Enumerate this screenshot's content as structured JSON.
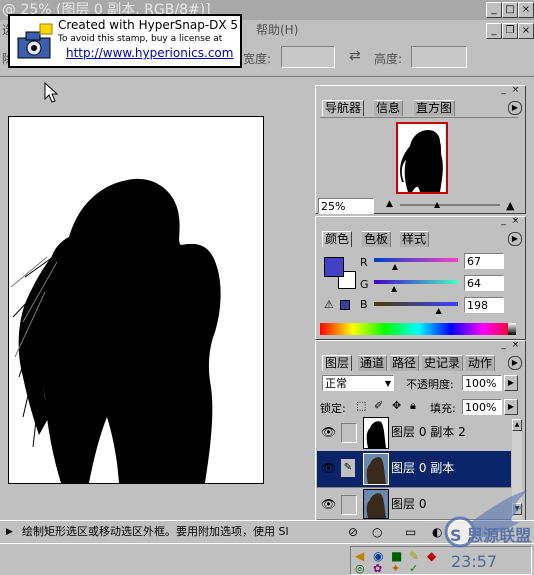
{
  "window": {
    "title": "@ 25% (图层 0 副本, RGB/8#)]",
    "menu_left": "选",
    "menu_help": "帮助(H)"
  },
  "stamp": {
    "line1": "Created with HyperSnap-DX 5",
    "line2": "To avoid this stamp, buy a license at",
    "line3": "http://www.hyperionics.com"
  },
  "options": {
    "left_label": "除",
    "width_label": "宽度:",
    "swap_icon": "⇄",
    "height_label": "高度:"
  },
  "navigator": {
    "tabs": [
      "导航器",
      "信息",
      "直方图"
    ],
    "zoom": "25%"
  },
  "color": {
    "tabs": [
      "颜色",
      "色板",
      "样式"
    ],
    "r_label": "R",
    "g_label": "G",
    "b_label": "B",
    "r_value": "67",
    "g_value": "64",
    "b_value": "198",
    "r_pos": 0.26,
    "g_pos": 0.25,
    "b_pos": 0.78,
    "fg_color": "#4340c6",
    "warn_icon": "⚠"
  },
  "layers": {
    "tabs": [
      "图层",
      "通道",
      "路径",
      "史记录",
      "动作"
    ],
    "blend_mode": "正常",
    "opacity_label": "不透明度:",
    "opacity_value": "100%",
    "lock_label": "锁定:",
    "fill_label": "填充:",
    "fill_value": "100%",
    "items": [
      {
        "name": "图层 0 副本 2",
        "selected": false
      },
      {
        "name": "图层 0 副本",
        "selected": true
      },
      {
        "name": "图层 0",
        "selected": false
      }
    ]
  },
  "statusbar": {
    "text": "绘制矩形选区或移动选区外框。要用附加选项，使用 Sl"
  },
  "taskbar": {
    "clock": "23:57",
    "watermark": "S 思源联盟"
  }
}
